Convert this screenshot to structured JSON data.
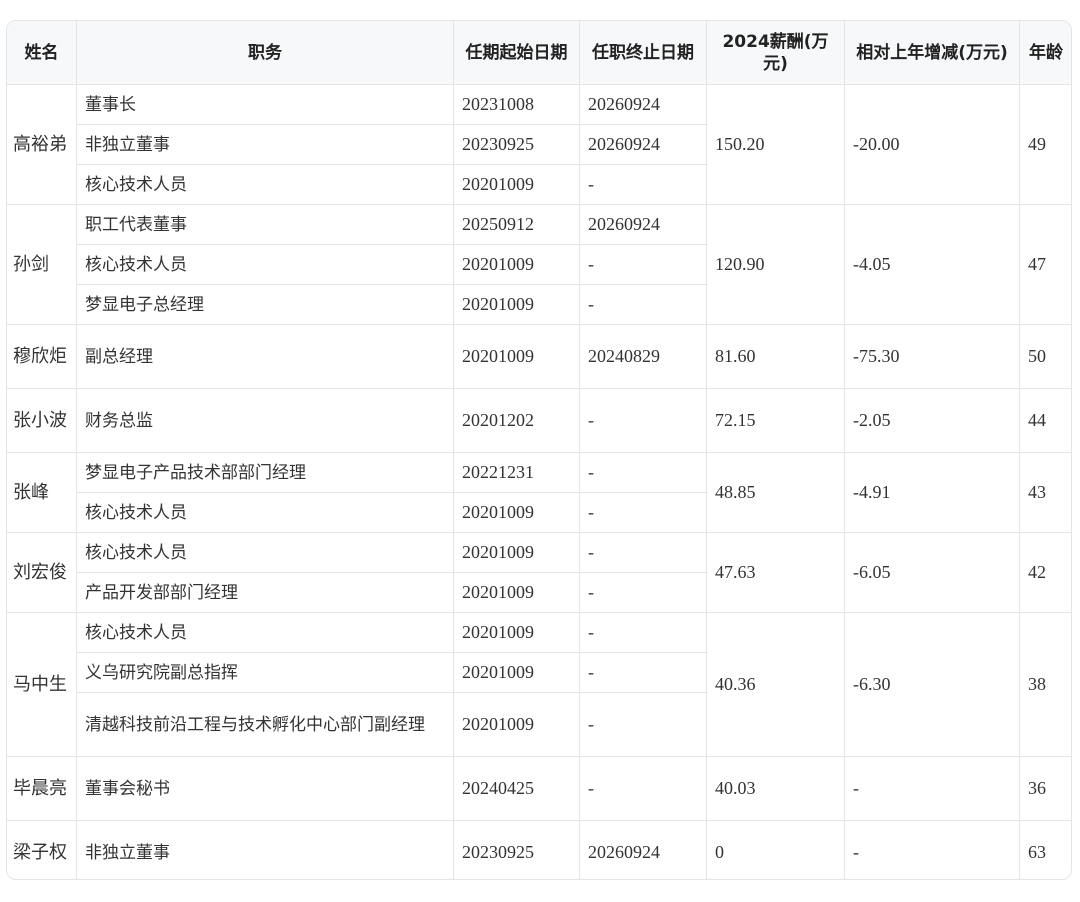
{
  "headers": {
    "name": "姓名",
    "position": "职务",
    "start": "任期起始日期",
    "end": "任职终止日期",
    "salary": "2024薪酬(万元)",
    "change": "相对上年增减(万元)",
    "age": "年龄"
  },
  "people": [
    {
      "name": "高裕弟",
      "salary": "150.20",
      "change": "-20.00",
      "age": "49",
      "roles": [
        {
          "position": "董事长",
          "start": "20231008",
          "end": "20260924"
        },
        {
          "position": "非独立董事",
          "start": "20230925",
          "end": "20260924"
        },
        {
          "position": "核心技术人员",
          "start": "20201009",
          "end": "-"
        }
      ]
    },
    {
      "name": "孙剑",
      "salary": "120.90",
      "change": "-4.05",
      "age": "47",
      "roles": [
        {
          "position": "职工代表董事",
          "start": "20250912",
          "end": "20260924"
        },
        {
          "position": "核心技术人员",
          "start": "20201009",
          "end": "-"
        },
        {
          "position": "梦显电子总经理",
          "start": "20201009",
          "end": "-"
        }
      ]
    },
    {
      "name": "穆欣炬",
      "salary": "81.60",
      "change": "-75.30",
      "age": "50",
      "roles": [
        {
          "position": "副总经理",
          "start": "20201009",
          "end": "20240829"
        }
      ]
    },
    {
      "name": "张小波",
      "salary": "72.15",
      "change": "-2.05",
      "age": "44",
      "roles": [
        {
          "position": "财务总监",
          "start": "20201202",
          "end": "-"
        }
      ]
    },
    {
      "name": "张峰",
      "salary": "48.85",
      "change": "-4.91",
      "age": "43",
      "roles": [
        {
          "position": "梦显电子产品技术部部门经理",
          "start": "20221231",
          "end": "-"
        },
        {
          "position": "核心技术人员",
          "start": "20201009",
          "end": "-"
        }
      ]
    },
    {
      "name": "刘宏俊",
      "salary": "47.63",
      "change": "-6.05",
      "age": "42",
      "roles": [
        {
          "position": "核心技术人员",
          "start": "20201009",
          "end": "-"
        },
        {
          "position": "产品开发部部门经理",
          "start": "20201009",
          "end": "-"
        }
      ]
    },
    {
      "name": "马中生",
      "salary": "40.36",
      "change": "-6.30",
      "age": "38",
      "roles": [
        {
          "position": "核心技术人员",
          "start": "20201009",
          "end": "-"
        },
        {
          "position": "义乌研究院副总指挥",
          "start": "20201009",
          "end": "-"
        },
        {
          "position": "清越科技前沿工程与技术孵化中心部门副经理",
          "start": "20201009",
          "end": "-"
        }
      ]
    },
    {
      "name": "毕晨亮",
      "salary": "40.03",
      "change": "-",
      "age": "36",
      "roles": [
        {
          "position": "董事会秘书",
          "start": "20240425",
          "end": "-"
        }
      ]
    },
    {
      "name": "梁子权",
      "salary": "0",
      "change": "-",
      "age": "63",
      "roles": [
        {
          "position": "非独立董事",
          "start": "20230925",
          "end": "20260924"
        }
      ]
    }
  ]
}
